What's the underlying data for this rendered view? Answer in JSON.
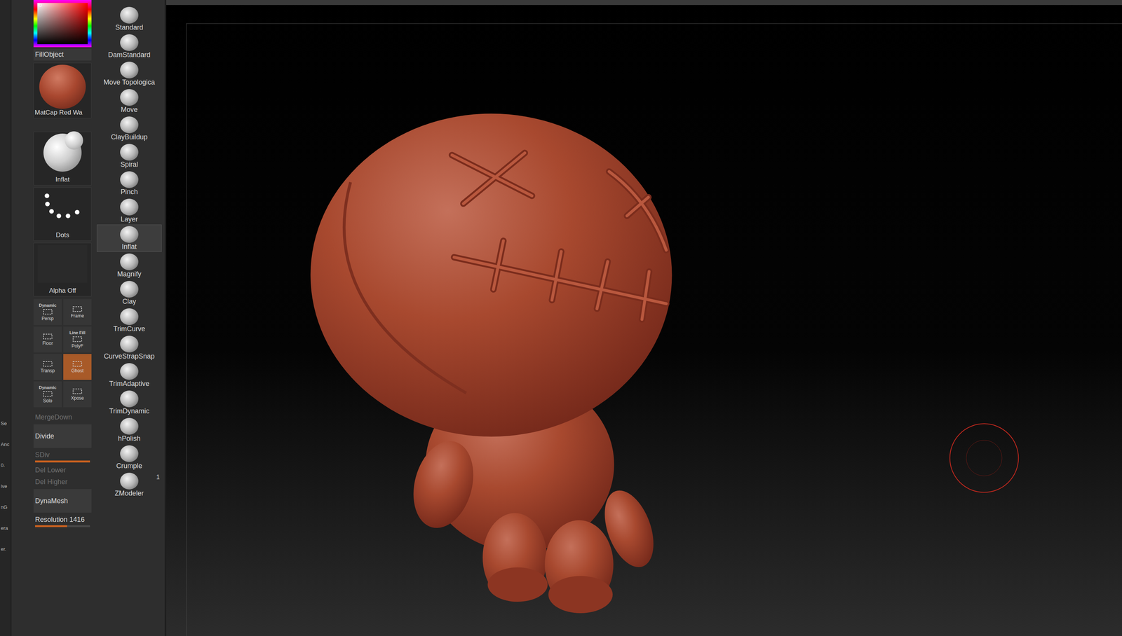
{
  "edge_labels": [
    "Se",
    "Anc",
    "0.",
    "ive",
    "nG",
    "era",
    "er."
  ],
  "color_picker": {
    "label": "FillObject"
  },
  "material": {
    "label": "MatCap Red Wa"
  },
  "brush": {
    "label": "Inflat"
  },
  "stroke": {
    "label": "Dots"
  },
  "alpha": {
    "label": "Alpha Off"
  },
  "toggles": [
    {
      "top": "Dynamic",
      "label": "Persp",
      "active": false
    },
    {
      "top": "",
      "label": "Frame",
      "active": false
    },
    {
      "top": "",
      "label": "Floor",
      "active": false
    },
    {
      "top": "Line Fill",
      "label": "PolyF",
      "active": false
    },
    {
      "top": "",
      "label": "Transp",
      "active": false
    },
    {
      "top": "",
      "label": "Ghost",
      "active": true
    },
    {
      "top": "Dynamic",
      "label": "Solo",
      "active": false
    },
    {
      "top": "",
      "label": "Xpose",
      "active": false
    }
  ],
  "geometry": [
    {
      "label": "MergeDown",
      "kind": "text",
      "disabled": true
    },
    {
      "label": "Divide",
      "kind": "button",
      "disabled": false
    },
    {
      "label": "SDiv",
      "kind": "slider",
      "disabled": true,
      "level": 1
    },
    {
      "label": "Del Lower",
      "kind": "text",
      "disabled": true
    },
    {
      "label": "Del Higher",
      "kind": "text",
      "disabled": true
    },
    {
      "label": "DynaMesh",
      "kind": "button",
      "disabled": false
    },
    {
      "label": "Resolution 1416",
      "kind": "slider",
      "disabled": false,
      "level": 0.58
    }
  ],
  "brushes": [
    {
      "label": "Standard",
      "selected": false,
      "badge": ""
    },
    {
      "label": "DamStandard",
      "selected": false,
      "badge": ""
    },
    {
      "label": "Move Topologica",
      "selected": false,
      "badge": ""
    },
    {
      "label": "Move",
      "selected": false,
      "badge": ""
    },
    {
      "label": "ClayBuildup",
      "selected": false,
      "badge": ""
    },
    {
      "label": "Spiral",
      "selected": false,
      "badge": ""
    },
    {
      "label": "Pinch",
      "selected": false,
      "badge": ""
    },
    {
      "label": "Layer",
      "selected": false,
      "badge": ""
    },
    {
      "label": "Inflat",
      "selected": true,
      "badge": ""
    },
    {
      "label": "Magnify",
      "selected": false,
      "badge": ""
    },
    {
      "label": "Clay",
      "selected": false,
      "badge": ""
    },
    {
      "label": "TrimCurve",
      "selected": false,
      "badge": ""
    },
    {
      "label": "CurveStrapSnap",
      "selected": false,
      "badge": ""
    },
    {
      "label": "TrimAdaptive",
      "selected": false,
      "badge": ""
    },
    {
      "label": "TrimDynamic",
      "selected": false,
      "badge": ""
    },
    {
      "label": "hPolish",
      "selected": false,
      "badge": ""
    },
    {
      "label": "Crumple",
      "selected": false,
      "badge": ""
    },
    {
      "label": "ZModeler",
      "selected": false,
      "badge": "1"
    }
  ]
}
